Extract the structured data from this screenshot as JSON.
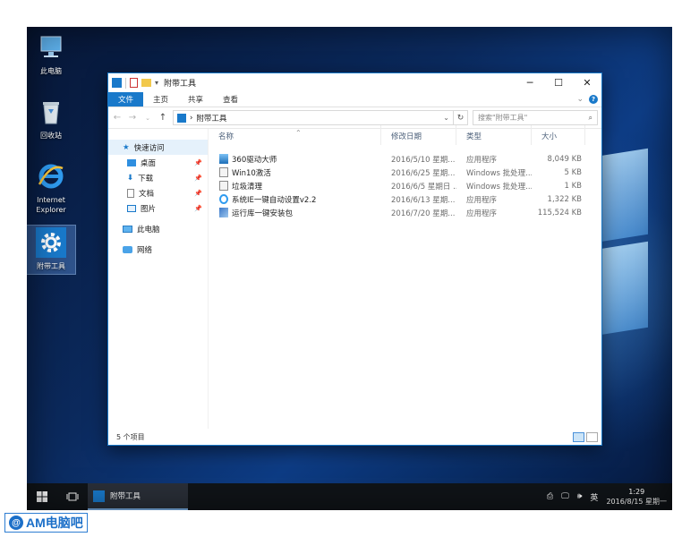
{
  "desktop": {
    "icons": [
      {
        "label": "此电脑",
        "icon": "this-pc-icon"
      },
      {
        "label": "回收站",
        "icon": "recycle-bin-icon"
      },
      {
        "label": "Internet Explorer",
        "icon": "internet-explorer-icon"
      },
      {
        "label": "附带工具",
        "icon": "gear-icon"
      }
    ]
  },
  "window": {
    "title": "附带工具",
    "ribbon_tabs": [
      "文件",
      "主页",
      "共享",
      "查看"
    ],
    "address": {
      "separator": "›",
      "path": "附带工具"
    },
    "search_placeholder": "搜索\"附带工具\"",
    "nav": {
      "quick_access": "快速访问",
      "items": [
        "桌面",
        "下载",
        "文档",
        "图片"
      ],
      "this_pc": "此电脑",
      "network": "网络"
    },
    "columns": [
      "名称",
      "修改日期",
      "类型",
      "大小"
    ],
    "files": [
      {
        "name": "360驱动大师",
        "date": "2016/5/10 星期...",
        "type": "应用程序",
        "size": "8,049 KB",
        "icon": "app-icon"
      },
      {
        "name": "Win10激活",
        "date": "2016/6/25 星期...",
        "type": "Windows 批处理...",
        "size": "5 KB",
        "icon": "batch-file-icon"
      },
      {
        "name": "垃圾清理",
        "date": "2016/6/5 星期日 ...",
        "type": "Windows 批处理...",
        "size": "1 KB",
        "icon": "batch-file-icon"
      },
      {
        "name": "系统IE一键自动设置v2.2",
        "date": "2016/6/13 星期...",
        "type": "应用程序",
        "size": "1,322 KB",
        "icon": "ie-app-icon"
      },
      {
        "name": "运行库一键安装包",
        "date": "2016/7/20 星期...",
        "type": "应用程序",
        "size": "115,524 KB",
        "icon": "installer-icon"
      }
    ],
    "status": "5 个项目"
  },
  "taskbar": {
    "app_label": "附带工具",
    "ime": "英",
    "time": "1:29",
    "date": "2016/8/15 星期一"
  },
  "watermark": {
    "text": "AM电脑吧"
  },
  "colors": {
    "accent": "#1979ca",
    "taskbar": "#101418",
    "desktop": "#0b2a5e"
  }
}
